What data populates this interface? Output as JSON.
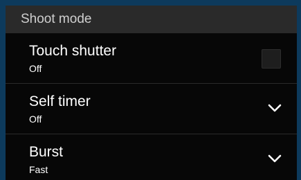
{
  "header": {
    "title": "Shoot mode"
  },
  "settings": [
    {
      "title": "Touch shutter",
      "value": "Off",
      "control": "checkbox",
      "checked": false
    },
    {
      "title": "Self timer",
      "value": "Off",
      "control": "dropdown"
    },
    {
      "title": "Burst",
      "value": "Fast",
      "control": "dropdown"
    }
  ],
  "colors": {
    "background": "#070707",
    "header": "#2a2a2a",
    "text": "#ffffff",
    "border": "#0d3a5c"
  }
}
